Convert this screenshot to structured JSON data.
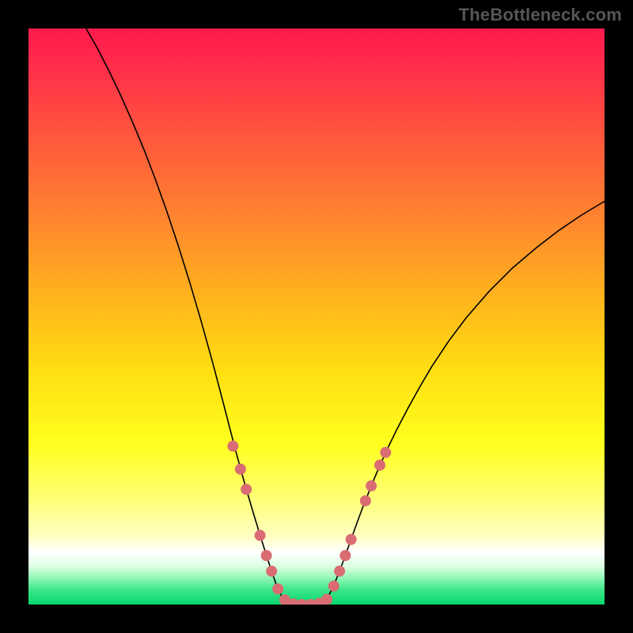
{
  "watermark": "TheBottleneck.com",
  "chart_data": {
    "type": "line",
    "title": "",
    "xlabel": "",
    "ylabel": "",
    "xlim": [
      0,
      100
    ],
    "ylim": [
      0,
      100
    ],
    "background_gradient": {
      "stops": [
        {
          "pos": 0.0,
          "color": "#ff1a4d"
        },
        {
          "pos": 0.06,
          "color": "#ff2b4a"
        },
        {
          "pos": 0.15,
          "color": "#ff4a41"
        },
        {
          "pos": 0.3,
          "color": "#ff7b32"
        },
        {
          "pos": 0.45,
          "color": "#ffae1f"
        },
        {
          "pos": 0.6,
          "color": "#ffe012"
        },
        {
          "pos": 0.72,
          "color": "#ffff1e"
        },
        {
          "pos": 0.82,
          "color": "#ffff7a"
        },
        {
          "pos": 0.88,
          "color": "#ffffc0"
        },
        {
          "pos": 0.91,
          "color": "#ffffff"
        },
        {
          "pos": 0.935,
          "color": "#d9ffe0"
        },
        {
          "pos": 0.955,
          "color": "#8cf7b3"
        },
        {
          "pos": 0.975,
          "color": "#3be689"
        },
        {
          "pos": 1.0,
          "color": "#09d66c"
        }
      ]
    },
    "series": [
      {
        "name": "bottleneck-v-curve",
        "stroke": "#000000",
        "stroke_width": 1.6,
        "points": [
          {
            "x": 10.0,
            "y": 100.0
          },
          {
            "x": 12.0,
            "y": 96.5
          },
          {
            "x": 14.0,
            "y": 92.6
          },
          {
            "x": 16.0,
            "y": 88.4
          },
          {
            "x": 18.0,
            "y": 83.9
          },
          {
            "x": 20.0,
            "y": 79.1
          },
          {
            "x": 22.0,
            "y": 73.9
          },
          {
            "x": 24.0,
            "y": 68.3
          },
          {
            "x": 26.0,
            "y": 62.3
          },
          {
            "x": 28.0,
            "y": 55.9
          },
          {
            "x": 30.0,
            "y": 49.1
          },
          {
            "x": 32.0,
            "y": 41.9
          },
          {
            "x": 34.0,
            "y": 34.3
          },
          {
            "x": 35.0,
            "y": 30.4
          },
          {
            "x": 36.0,
            "y": 26.6
          },
          {
            "x": 37.0,
            "y": 22.9
          },
          {
            "x": 38.0,
            "y": 19.4
          },
          {
            "x": 39.0,
            "y": 16.0
          },
          {
            "x": 40.0,
            "y": 12.7
          },
          {
            "x": 41.0,
            "y": 9.5
          },
          {
            "x": 42.0,
            "y": 6.4
          },
          {
            "x": 43.0,
            "y": 3.5
          },
          {
            "x": 44.0,
            "y": 1.3
          },
          {
            "x": 45.0,
            "y": 0.4
          },
          {
            "x": 46.0,
            "y": 0.1
          },
          {
            "x": 47.0,
            "y": 0.0
          },
          {
            "x": 48.0,
            "y": 0.0
          },
          {
            "x": 49.0,
            "y": 0.0
          },
          {
            "x": 50.0,
            "y": 0.1
          },
          {
            "x": 51.0,
            "y": 0.4
          },
          {
            "x": 52.0,
            "y": 1.3
          },
          {
            "x": 53.0,
            "y": 3.3
          },
          {
            "x": 54.0,
            "y": 5.8
          },
          {
            "x": 55.0,
            "y": 8.5
          },
          {
            "x": 56.0,
            "y": 11.3
          },
          {
            "x": 57.0,
            "y": 14.1
          },
          {
            "x": 58.0,
            "y": 16.8
          },
          {
            "x": 60.0,
            "y": 21.8
          },
          {
            "x": 62.0,
            "y": 26.4
          },
          {
            "x": 64.0,
            "y": 30.5
          },
          {
            "x": 66.0,
            "y": 34.3
          },
          {
            "x": 68.0,
            "y": 37.9
          },
          {
            "x": 70.0,
            "y": 41.3
          },
          {
            "x": 73.0,
            "y": 45.8
          },
          {
            "x": 76.0,
            "y": 49.8
          },
          {
            "x": 80.0,
            "y": 54.4
          },
          {
            "x": 84.0,
            "y": 58.4
          },
          {
            "x": 88.0,
            "y": 61.8
          },
          {
            "x": 92.0,
            "y": 64.9
          },
          {
            "x": 96.0,
            "y": 67.6
          },
          {
            "x": 100.0,
            "y": 70.0
          }
        ]
      }
    ],
    "markers": {
      "fill": "#d96d73",
      "radius": 7,
      "points": [
        {
          "x": 35.5,
          "y": 27.5
        },
        {
          "x": 36.8,
          "y": 23.5
        },
        {
          "x": 37.8,
          "y": 20.0
        },
        {
          "x": 40.2,
          "y": 12.0
        },
        {
          "x": 41.3,
          "y": 8.5
        },
        {
          "x": 42.2,
          "y": 5.8
        },
        {
          "x": 43.3,
          "y": 2.7
        },
        {
          "x": 44.5,
          "y": 0.8
        },
        {
          "x": 46.0,
          "y": 0.1
        },
        {
          "x": 47.5,
          "y": 0.0
        },
        {
          "x": 49.0,
          "y": 0.0
        },
        {
          "x": 50.5,
          "y": 0.2
        },
        {
          "x": 51.8,
          "y": 0.9
        },
        {
          "x": 53.0,
          "y": 3.2
        },
        {
          "x": 54.0,
          "y": 5.8
        },
        {
          "x": 55.0,
          "y": 8.5
        },
        {
          "x": 56.0,
          "y": 11.3
        },
        {
          "x": 58.5,
          "y": 18.0
        },
        {
          "x": 59.5,
          "y": 20.6
        },
        {
          "x": 61.0,
          "y": 24.2
        },
        {
          "x": 62.0,
          "y": 26.4
        }
      ]
    }
  }
}
